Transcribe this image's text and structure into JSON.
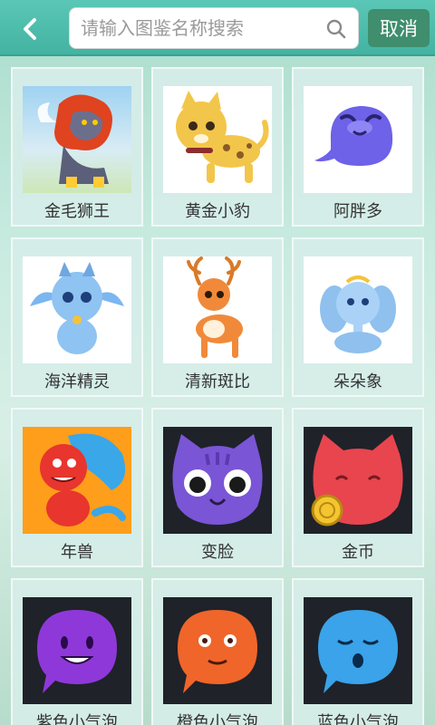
{
  "header": {
    "back_icon": "chevron-left-icon",
    "search_placeholder": "请输入图鉴名称搜索",
    "search_icon": "search-icon",
    "cancel_label": "取消"
  },
  "items": [
    {
      "label": "金毛狮王"
    },
    {
      "label": "黄金小豹"
    },
    {
      "label": "阿胖多"
    },
    {
      "label": "海洋精灵"
    },
    {
      "label": "清新斑比"
    },
    {
      "label": "朵朵象"
    },
    {
      "label": "年兽"
    },
    {
      "label": "变脸"
    },
    {
      "label": "金币"
    },
    {
      "label": "紫色小气泡"
    },
    {
      "label": "橙色小气泡"
    },
    {
      "label": "蓝色小气泡"
    }
  ],
  "colors": {
    "header": "#48b8a6",
    "cancel_button": "#3f8e6e",
    "card": "#d6ede8"
  }
}
